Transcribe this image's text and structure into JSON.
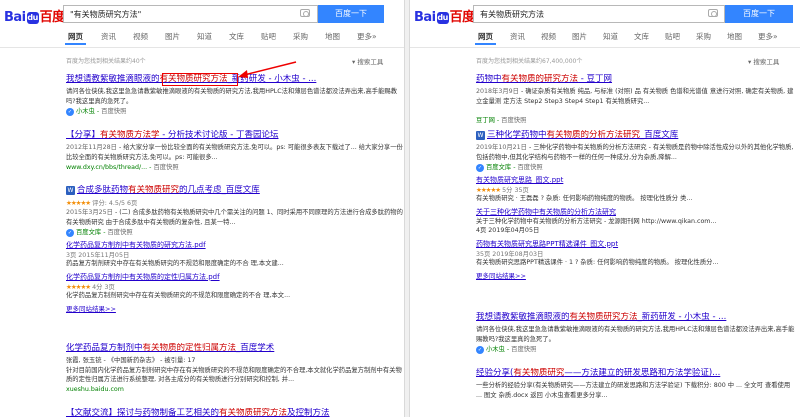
{
  "common": {
    "logo": {
      "part1": "Bai",
      "paw": "du",
      "part2": "百度"
    },
    "search_button": "百度一下",
    "tabs": [
      "网页",
      "资讯",
      "视频",
      "图片",
      "知道",
      "文库",
      "贴吧",
      "采购",
      "地图",
      "更多»"
    ],
    "tools": "搜索工具"
  },
  "left": {
    "query": "\"有关物质研究方法\"",
    "result_count": "百度为您找到相关结果约40个",
    "results": [
      {
        "title_pre": "我想请教紫敏推滴眼液的",
        "title_em": "有关物质研究方法",
        "title_post": "_新药研发 - 小木虫 - ...",
        "abstract": "请问各位侠侠,我这里急急请教紫敏推滴眼液的有关物质的研究方法,我用HPLC法和薄层色谱法都没法弄出来,高手能赐教吗?我这里真的急死了。",
        "url": "小木虫",
        "snapshot": "百度快照"
      },
      {
        "title_pre": "【分享】",
        "title_em": "有关物质方法学",
        "title_post": " - 分析技术讨论版 - 丁香园论坛",
        "date": "2012年11月28日",
        "abstract": " - 给大家分享一份比较全面的有关物质研究方法,免可以。ps: 可能很多表友下载过了... 给大家分享一份比较全面的有关物质研究方法,免可以。ps: 可能很多...",
        "url": "www.dxy.cn/bbs/thread/...",
        "snapshot": "百度快照"
      },
      {
        "title_pre": "合成多肽药物",
        "title_em": "有关物质研究",
        "title_post": "的几点考虑_百度文库",
        "stars": "★★★★★",
        "rating": "评分: 4.5/5 6页",
        "date": "2015年3月25日",
        "abstract": " - (二) 合成多肽药物有关物质研究中几个需关注的问题 1、同时采用不同原理的方法进行合成多肽药物的有关物质研究 由于合成多肽中有关物质的复杂性, 且某一特...",
        "url": "百度文库",
        "snapshot": "百度快照",
        "subs": [
          {
            "title": "化学药品复方制剂中有关物质的研究方法.pdf",
            "meta": "3页  2015年11月05日",
            "abstract": "药品复方制剂研究中存在有关物质研究的不规范和限度确定的不合 理,本文建..."
          },
          {
            "title": "化学药品复方制剂中有关物质的定性归属方法.pdf",
            "stars": "★★★★★",
            "meta": "4分  3页",
            "abstract": "化学药品复方制剂研究中存在有关物质研究的不规范和限度确定的不合 理,本文..."
          }
        ],
        "more": "更多同站结果>>"
      },
      {
        "title_pre": "化学药品复方制剂中",
        "title_em": "有关物质的定性归属方法",
        "title_post": "_百度学术",
        "abstract": "张霞, 张玉铳 - 《中国新药杂志》 - 被引量: 17\n针对目前国内化学药品复方制剂研究中存在有关物质研究的不规范和限度确定的不合理,本文就化学药品复方制剂中有关物质的定性归属方法进行系统整理, 对各主成分的有关物质进行分别研究和控制, 并...",
        "url": "xueshu.baidu.com",
        "snapshot": ""
      },
      {
        "title_pre": "【文献交流】探讨与药物制备工艺相关的",
        "title_em": "有关物质研究方法",
        "title_post": "及控制方法",
        "abstract": "",
        "url": "",
        "snapshot": ""
      }
    ]
  },
  "right": {
    "query": "有关物质研究方法",
    "result_count": "百度为您找到相关结果约67,400,000个",
    "results": [
      {
        "title_pre": "药物中",
        "title_em": "有关物质的研究方法",
        "title_post": " - 豆丁网",
        "date": "2018年3月9日",
        "abstract": " - 确证杂质有关物质 纯品, 与标准 (对照) 品 有关物质 色谱和光谱值 意进行对照, 确定有关物质, 建立金量测 定方法 Step2 Step3 Step4 Step1 有关物质研究...",
        "url": "豆丁网",
        "snapshot": "百度快照"
      },
      {
        "title_pre": "三种化学药物中",
        "title_em": "有关物质的分析方法研究",
        "title_post": "_百度文库",
        "date": "2019年10月21日",
        "abstract": " - 三种化学药物中有关物质的分析方法研究 - 有关物质是药物中除活性成分以外的其他化学物质, 包括药物中,但其化学结构与药物不一样的任何一种成分,分为杂质,降解...",
        "url": "百度文库",
        "snapshot": "百度快照",
        "subs": [
          {
            "title": "有关物质研究思路_图文.ppt",
            "stars": "★★★★★",
            "meta": "5分  35页",
            "abstract": "有关物质研究 · 王磊磊 ? 杂质: 任何影响药物纯度的物质。 按理化性质分 类..."
          },
          {
            "title": "关于三种化学药物中有关物质的分析方法研究",
            "meta": "",
            "abstract": "关于三种化学药物中有关物质的分析方法研究 - 龙源期刊网 http://www.qikan.com...\n4页  2019年04月05日"
          },
          {
            "title": "药物有关物质研究思路PPT精选课件_图文.ppt",
            "meta": "35页  2019年08月03日",
            "abstract": "有关物质研究思路PPT精选课件 · 1 ? 杂质: 任何影响药物纯度的物质。 按理化性质分..."
          }
        ],
        "more": "更多同站结果>>"
      },
      {
        "title_pre": "我想请教紫敏推滴眼液的",
        "title_em": "有关物质研究方法",
        "title_post": "_新药研发 - 小木虫 - ...",
        "abstract": "请问各位侠侠,我这里急急请教紫敏推滴眼液的有关物质的研究方法,我用HPLC法和薄层色谱法都没法弄出来,高手能赐教吗?我这里真的急死了。",
        "url": "小木虫",
        "snapshot": "百度快照"
      },
      {
        "title_pre": "经验分享(",
        "title_em": "有关物质研究",
        "title_post": "——方法建立的研发思路和方法学验证)...",
        "abstract": "一些分析的经验分享(有关物质研究——方法建立的研发思路和方法学验证) 下载积分: 800 中 ... 全文可 查看使用 ... 图文 杂质.docx 返回 小木虫查看更多分享...",
        "url": "",
        "snapshot": ""
      }
    ]
  }
}
